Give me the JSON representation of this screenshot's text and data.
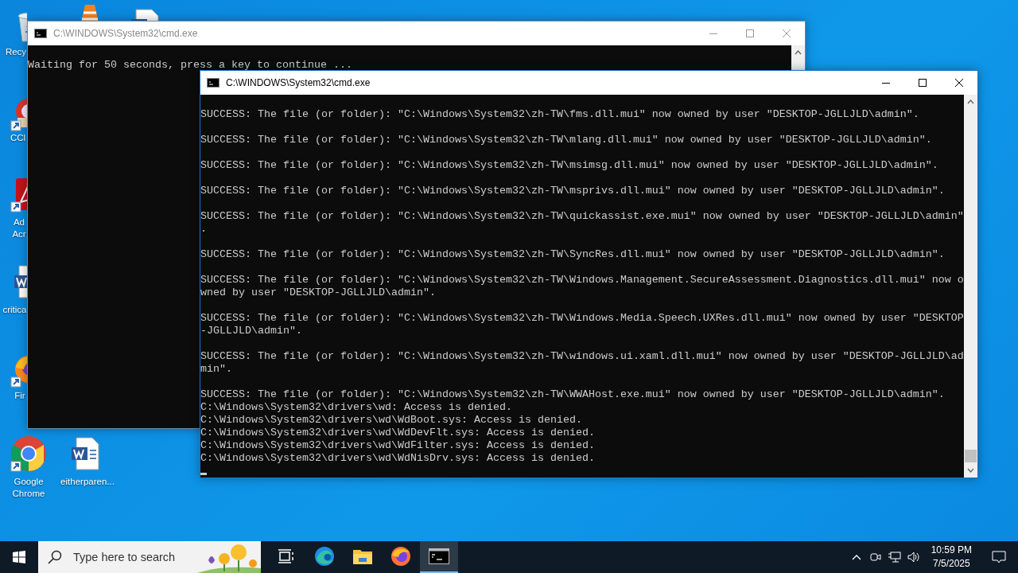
{
  "desktop_icons": [
    {
      "kind": "recycle-bin",
      "shortcut": false,
      "label_lines": [
        "Recy"
      ]
    },
    {
      "kind": "vlc",
      "shortcut": false
    },
    {
      "kind": "word",
      "shortcut": false
    },
    {
      "kind": "ccleaner",
      "shortcut": true,
      "label_lines": [
        "CCl"
      ]
    },
    {
      "kind": "acrobat",
      "shortcut": true,
      "label_lines": [
        "Ad",
        "Acr"
      ]
    },
    {
      "kind": "word",
      "shortcut": false,
      "label_lines": [
        "critica"
      ]
    },
    {
      "kind": "firefox",
      "shortcut": true,
      "label_lines": [
        "Fir"
      ]
    },
    {
      "kind": "chrome",
      "shortcut": true,
      "label_lines": [
        "Google",
        "Chrome"
      ]
    },
    {
      "kind": "word",
      "shortcut": false,
      "label_lines": [
        "eitherparen..."
      ]
    }
  ],
  "windows": [
    {
      "title": "C:\\WINDOWS\\System32\\cmd.exe",
      "active": false,
      "cursor": false,
      "blocks": [
        [
          "Waiting for 50 seconds, press a key to continue ..."
        ]
      ]
    },
    {
      "title": "C:\\WINDOWS\\System32\\cmd.exe",
      "active": true,
      "cursor": true,
      "blocks": [
        [
          "SUCCESS: The file (or folder): \"C:\\Windows\\System32\\zh-TW\\fms.dll.mui\" now owned by user \"DESKTOP-JGLLJLD\\admin\"."
        ],
        [
          "SUCCESS: The file (or folder): \"C:\\Windows\\System32\\zh-TW\\mlang.dll.mui\" now owned by user \"DESKTOP-JGLLJLD\\admin\"."
        ],
        [
          "SUCCESS: The file (or folder): \"C:\\Windows\\System32\\zh-TW\\msimsg.dll.mui\" now owned by user \"DESKTOP-JGLLJLD\\admin\"."
        ],
        [
          "SUCCESS: The file (or folder): \"C:\\Windows\\System32\\zh-TW\\msprivs.dll.mui\" now owned by user \"DESKTOP-JGLLJLD\\admin\"."
        ],
        [
          "SUCCESS: The file (or folder): \"C:\\Windows\\System32\\zh-TW\\quickassist.exe.mui\" now owned by user \"DESKTOP-JGLLJLD\\admin\"",
          "."
        ],
        [
          "SUCCESS: The file (or folder): \"C:\\Windows\\System32\\zh-TW\\SyncRes.dll.mui\" now owned by user \"DESKTOP-JGLLJLD\\admin\"."
        ],
        [
          "SUCCESS: The file (or folder): \"C:\\Windows\\System32\\zh-TW\\Windows.Management.SecureAssessment.Diagnostics.dll.mui\" now o",
          "wned by user \"DESKTOP-JGLLJLD\\admin\"."
        ],
        [
          "SUCCESS: The file (or folder): \"C:\\Windows\\System32\\zh-TW\\Windows.Media.Speech.UXRes.dll.mui\" now owned by user \"DESKTOP",
          "-JGLLJLD\\admin\"."
        ],
        [
          "SUCCESS: The file (or folder): \"C:\\Windows\\System32\\zh-TW\\windows.ui.xaml.dll.mui\" now owned by user \"DESKTOP-JGLLJLD\\ad",
          "min\"."
        ],
        [
          "SUCCESS: The file (or folder): \"C:\\Windows\\System32\\zh-TW\\WWAHost.exe.mui\" now owned by user \"DESKTOP-JGLLJLD\\admin\".",
          "C:\\Windows\\System32\\drivers\\wd: Access is denied.",
          "C:\\Windows\\System32\\drivers\\wd\\WdBoot.sys: Access is denied.",
          "C:\\Windows\\System32\\drivers\\wd\\WdDevFlt.sys: Access is denied.",
          "C:\\Windows\\System32\\drivers\\wd\\WdFilter.sys: Access is denied.",
          "C:\\Windows\\System32\\drivers\\wd\\WdNisDrv.sys: Access is denied."
        ]
      ]
    }
  ],
  "taskbar": {
    "search": {
      "placeholder": "Type here to search"
    },
    "apps": [
      {
        "kind": "task-view",
        "selected": false
      },
      {
        "kind": "edge",
        "selected": false
      },
      {
        "kind": "explorer",
        "selected": false
      },
      {
        "kind": "firefox",
        "selected": false
      },
      {
        "kind": "cmd",
        "selected": true
      }
    ],
    "clock": {
      "time": "10:59 PM",
      "date": "7/5/2025"
    }
  }
}
